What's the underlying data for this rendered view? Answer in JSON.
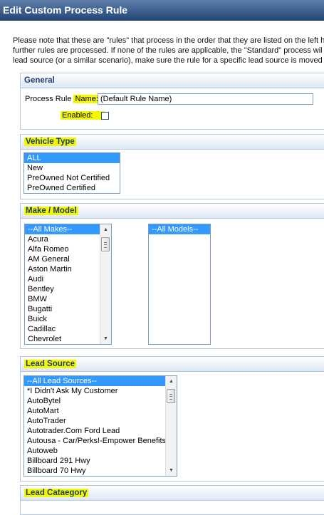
{
  "title": "Edit Custom Process Rule",
  "intro": {
    "line1": "Please note that these are \"rules\" that process in the order that they are listed on the left ha",
    "line2": "further rules are processed. If none of the rules are applicable, the \"Standard\" process wil",
    "line3": "lead source (or a similar scenario), make sure the rule for a specific lead source is moved"
  },
  "general": {
    "header": "General",
    "name_label_prefix": "Process Rule ",
    "name_label_highlight": "Name:",
    "name_value": "(Default Rule Name)",
    "enabled_label": "Enabled:",
    "enabled_checked": false
  },
  "vehicle_type": {
    "header": "Vehicle Type",
    "options": [
      "ALL",
      "New",
      "PreOwned Not Certified",
      "PreOwned Certified"
    ],
    "selected": "ALL"
  },
  "make_model": {
    "header": "Make / Model",
    "makes": [
      "--All Makes--",
      "Acura",
      "Alfa Romeo",
      "AM General",
      "Aston Martin",
      "Audi",
      "Bentley",
      "BMW",
      "Bugatti",
      "Buick",
      "Cadillac",
      "Chevrolet"
    ],
    "makes_selected": "--All Makes--",
    "models": [
      "--All Models--"
    ],
    "models_selected": "--All Models--"
  },
  "lead_source": {
    "header": "Lead Source",
    "options": [
      "--All Lead Sources--",
      "*I Didn't Ask My Customer",
      "AutoBytel",
      "AutoMart",
      "AutoTrader",
      "Autotrader.Com Ford Lead",
      "Autousa - Car/Perks!-Empower Benefits",
      "Autoweb",
      "Billboard 291 Hwy",
      "Billboard 70 Hwy"
    ],
    "selected": "--All Lead Sources--"
  },
  "lead_category": {
    "header": "Lead Cataegory"
  }
}
